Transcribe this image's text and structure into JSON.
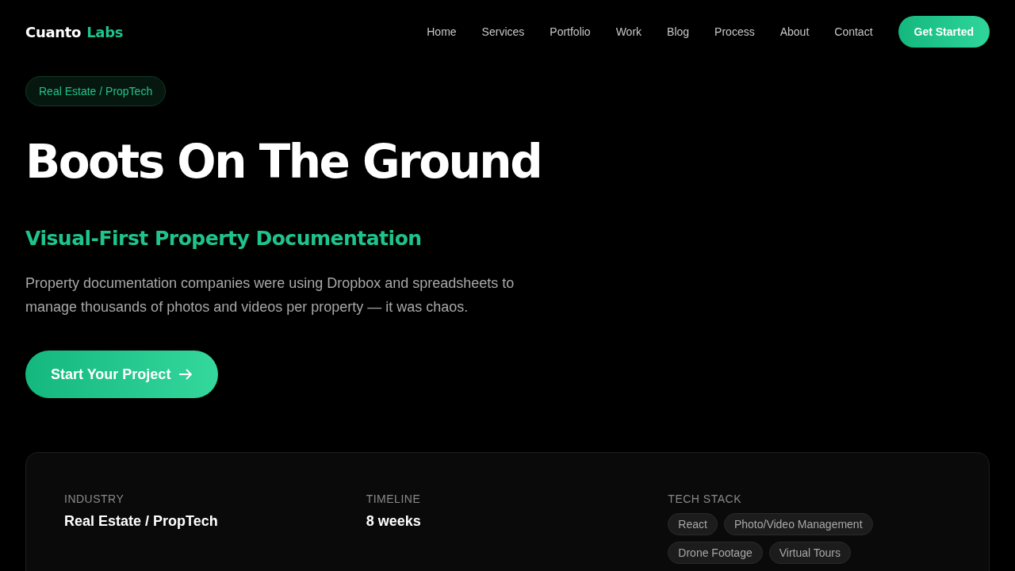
{
  "logo": {
    "first": "Cuanto",
    "second": "Labs"
  },
  "nav": {
    "links": [
      "Home",
      "Services",
      "Portfolio",
      "Work",
      "Blog",
      "Process",
      "About",
      "Contact"
    ],
    "cta": "Get Started"
  },
  "hero": {
    "badge": "Real Estate / PropTech",
    "title": "Boots On The Ground",
    "subtitle": "Visual-First Property Documentation",
    "description": "Property documentation companies were using Dropbox and spreadsheets to manage thousands of photos and videos per property — it was chaos.",
    "button": "Start Your Project"
  },
  "details": [
    {
      "kind": "text",
      "label": "INDUSTRY",
      "value": "Real Estate / PropTech"
    },
    {
      "kind": "text",
      "label": "TIMELINE",
      "value": "8 weeks"
    },
    {
      "kind": "tags",
      "label": "TECH STACK",
      "tags": [
        "React",
        "Photo/Video Management",
        "Drone Footage",
        "Virtual Tours"
      ]
    }
  ]
}
